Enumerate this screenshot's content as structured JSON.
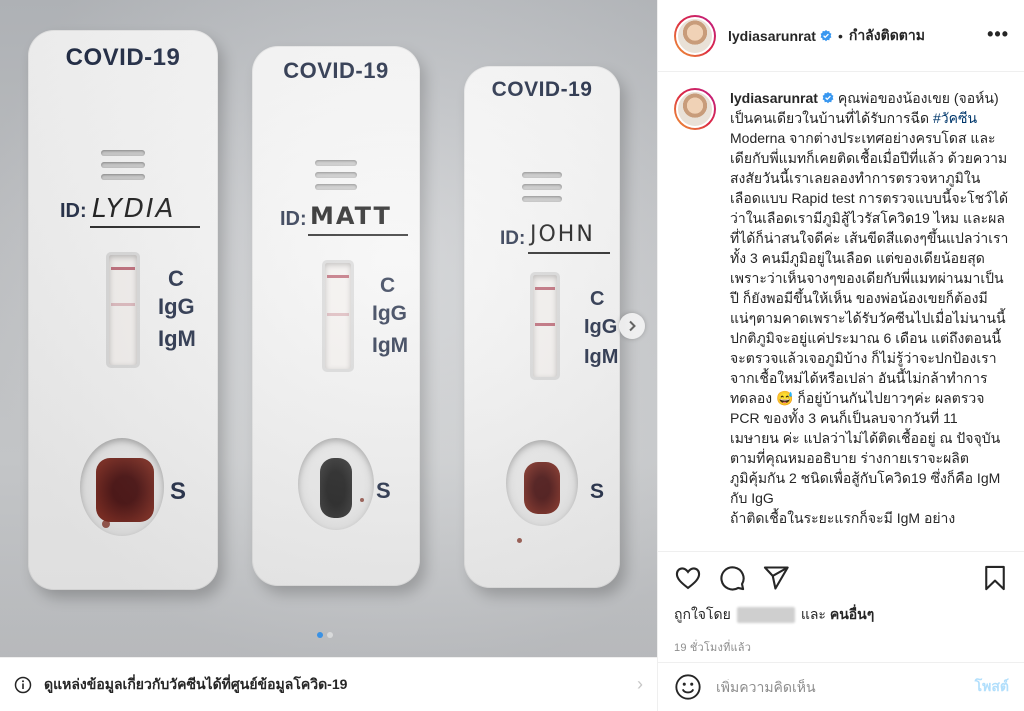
{
  "photo": {
    "tests": [
      {
        "brand": "COVID-19",
        "id_label": "ID:",
        "name": "LYDIA",
        "c": "C",
        "igg": "IgG",
        "igm": "IgM",
        "s": "S"
      },
      {
        "brand": "COVID-19",
        "id_label": "ID:",
        "name": "MATT",
        "c": "C",
        "igg": "IgG",
        "igm": "IgM",
        "s": "S"
      },
      {
        "brand": "COVID-19",
        "id_label": "ID:",
        "name": "JOHN",
        "c": "C",
        "igg": "IgG",
        "igm": "IgM",
        "s": "S"
      }
    ],
    "carousel": {
      "current": 1,
      "total": 2
    }
  },
  "info_bar": {
    "text": "ดูแหล่งข้อมูลเกี่ยวกับวัคซีนได้ที่ศูนย์ข้อมูลโควิด-19",
    "icon": "info-icon"
  },
  "header": {
    "username": "lydiasarunrat",
    "separator": "•",
    "follow_status": "กำลังติดตาม",
    "more": "•••"
  },
  "caption": {
    "username": "lydiasarunrat",
    "text_1": "คุณพ่อของน้องเขย (จอห์น) เป็นคนเดียวในบ้านที่ได้รับการฉีด ",
    "hashtag": "#วัคซีน",
    "text_2": " Moderna จากต่างประเทศอย่างครบโดส และเดียกับพี่แมทก็เคยติดเชื้อเมื่อปีที่แล้ว ด้วยความสงสัยวันนี้เราเลยลองทำการตรวจหาภูมิในเลือดแบบ Rapid test การตรวจแบบนี้จะโชว์ได้ว่าในเลือดเรามีภูมิสู้ไวรัสโควิด19 ไหม และผลที่ได้ก็น่าสนใจดีค่ะ เส้นขีดสีแดงๆขึ้นแปลว่าเราทั้ง 3 คนมีภูมิอยู่ในเลือด แต่ของเดียน้อยสุดเพราะว่าเห็นจางๆของเดียกับพี่แมทผ่านมาเป็นปี ก็ยังพอมีขึ้นให้เห็น ของพ่อน้องเขยก็ต้องมีแน่ๆตามคาดเพราะได้รับวัคซีนไปเมื่อไม่นานนี้ ปกติภูมิจะอยู่แค่ประมาณ 6 เดือน แต่ถึงตอนนี้จะตรวจแล้วเจอภูมิบ้าง ก็ไม่รู้ว่าจะปกป้องเราจากเชื้อใหม่ได้หรือเปล่า อันนี้ไม่กล้าทำการทดลอง ",
    "emoji": "😅",
    "text_3": " ก็อยู่บ้านกันไปยาวๆค่ะ ผลตรวจ PCR ของทั้ง 3 คนก็เป็นลบจากวันที่ 11 เมษายน ค่ะ แปลว่าไม่ได้ติดเชื้ออยู่ ณ ปัจจุบัน ตามที่คุณหมออธิบาย ร่างกายเราจะผลิตภูมิคุ้มกัน 2 ชนิดเพื่อสู้กับโควิด19 ซึ่งก็คือ IgM กับ IgG",
    "text_cut": "ถ้าติดเชื้อในระยะแรกก็จะมี IgM อย่าง"
  },
  "actions": {
    "icons": [
      "heart-icon",
      "comment-icon",
      "share-icon",
      "bookmark-icon"
    ],
    "likes_prefix": "ถูกใจโดย",
    "likes_and": "และ",
    "likes_others": "คนอื่นๆ",
    "time": "19 ชั่วโมงที่แล้ว"
  },
  "comment": {
    "placeholder": "เพิ่มความคิดเห็น",
    "post": "โพสต์",
    "icon": "smiley-icon"
  },
  "colors": {
    "link": "#00376b",
    "verified": "#3897f0",
    "post_disabled": "#b2dffc",
    "muted": "#8e8e8e",
    "band": "#b35060"
  }
}
